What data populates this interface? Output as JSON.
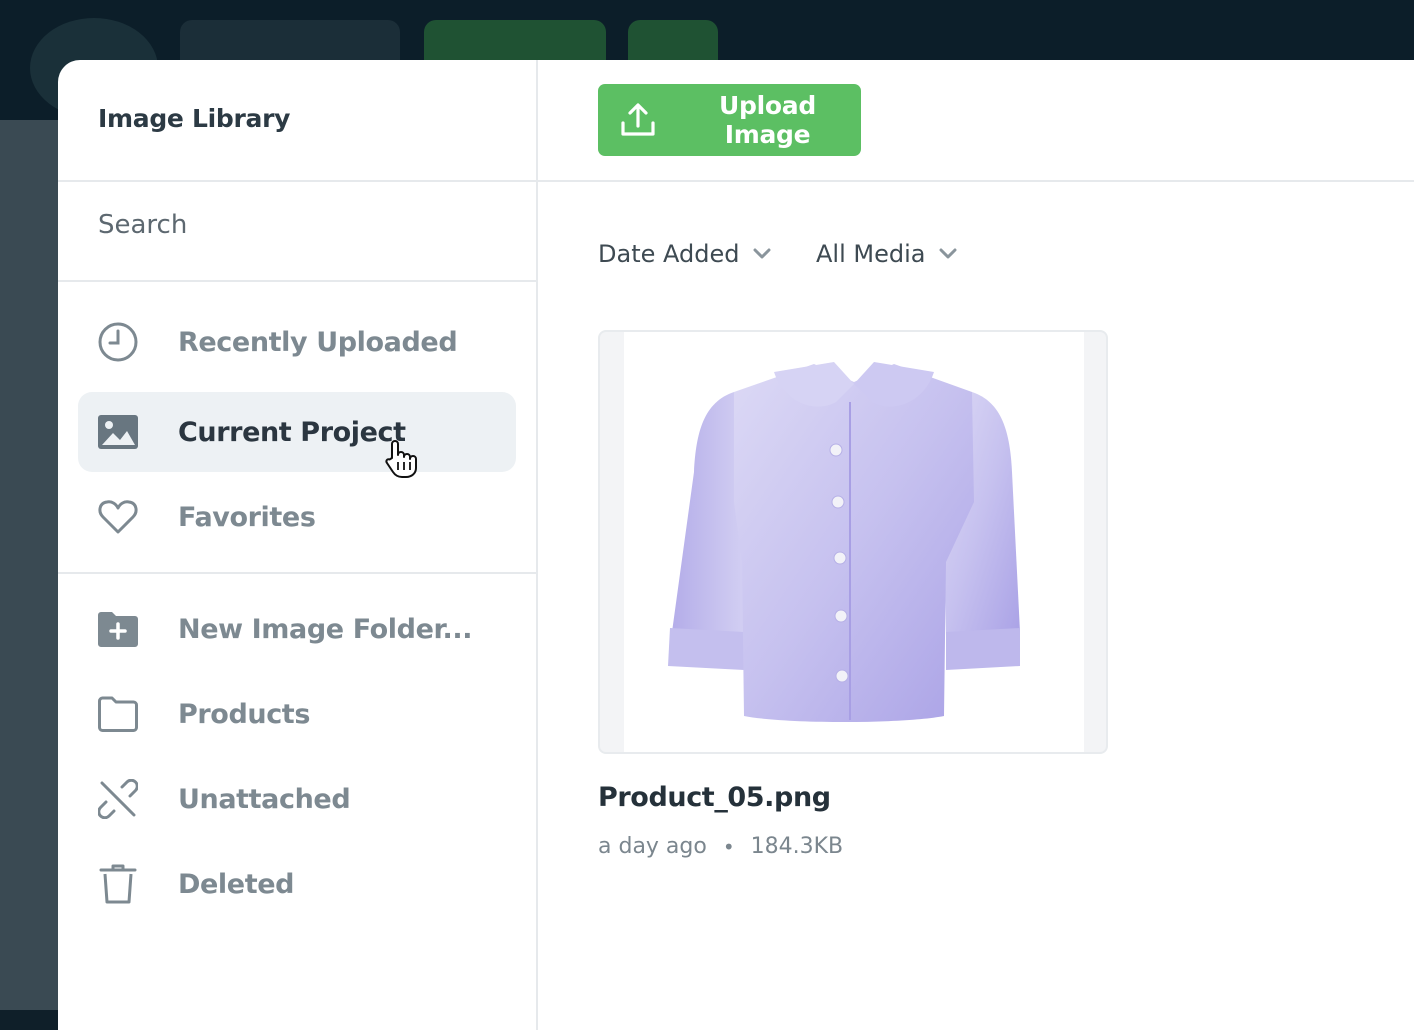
{
  "colors": {
    "accent": "#5cbf63",
    "active_bg": "#edf1f4",
    "muted": "#7d8991",
    "text": "#2b3640"
  },
  "modal": {
    "title": "Image Library"
  },
  "search": {
    "placeholder": "Search"
  },
  "sidebar": {
    "items": [
      {
        "label": "Recently Uploaded",
        "icon": "clock-icon",
        "active": false
      },
      {
        "label": "Current Project",
        "icon": "image-icon",
        "active": true
      },
      {
        "label": "Favorites",
        "icon": "heart-icon",
        "active": false
      },
      {
        "label": "New Image Folder...",
        "icon": "folder-plus-icon",
        "active": false
      },
      {
        "label": "Products",
        "icon": "folder-icon",
        "active": false
      },
      {
        "label": "Unattached",
        "icon": "unlink-icon",
        "active": false
      },
      {
        "label": "Deleted",
        "icon": "trash-icon",
        "active": false
      }
    ]
  },
  "toolbar": {
    "upload_label": "Upload Image",
    "upload_icon": "upload-icon"
  },
  "filters": {
    "sort_label": "Date Added",
    "media_label": "All Media"
  },
  "files": [
    {
      "name": "Product_05.png",
      "age": "a day ago",
      "size": "184.3KB",
      "thumbnail": "lavender-jacket"
    }
  ]
}
